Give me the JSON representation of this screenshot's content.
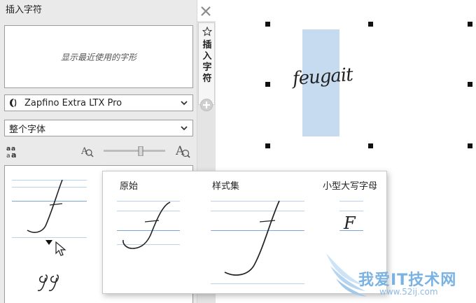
{
  "docker": {
    "title": "插入字符",
    "recent_placeholder": "显示最近使用的字形",
    "font_dropdown": {
      "value": "Zapfino Extra LTX Pro"
    },
    "range_dropdown": {
      "value": "整个字体"
    },
    "tab_label": "插入字符"
  },
  "canvas": {
    "text": "feugait",
    "selection_color": "#c6dbf0"
  },
  "popup": {
    "columns": [
      {
        "header": "原始"
      },
      {
        "header": "样式集"
      },
      {
        "header": "小型大写字母",
        "glyph": "F"
      }
    ]
  },
  "watermark": {
    "title": "我爱IT技术网",
    "url": "www.52ij.com"
  },
  "icons": {
    "close": "close-icon",
    "star": "star-icon",
    "add": "plus-circle-icon",
    "zoom_out": "zoom-out-icon",
    "zoom_in": "zoom-in-icon",
    "aa": "font-size-icon",
    "chevron": "chevron-down-icon"
  },
  "colors": {
    "guide_line": "#b9d3ec",
    "baseline": "#7aa7d6",
    "accent": "#7ab2e3"
  }
}
